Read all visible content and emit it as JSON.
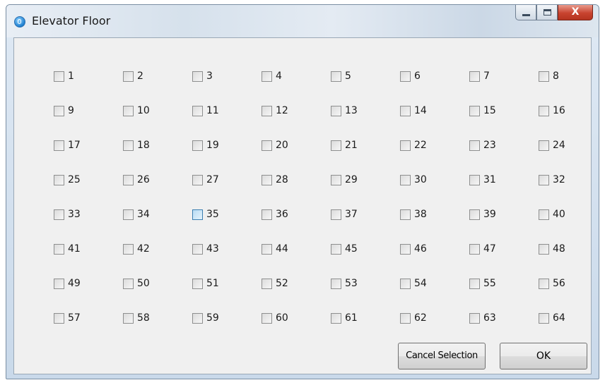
{
  "window": {
    "title": "Elevator Floor",
    "close_glyph": "X"
  },
  "floors": [
    "1",
    "2",
    "3",
    "4",
    "5",
    "6",
    "7",
    "8",
    "9",
    "10",
    "11",
    "12",
    "13",
    "14",
    "15",
    "16",
    "17",
    "18",
    "19",
    "20",
    "21",
    "22",
    "23",
    "24",
    "25",
    "26",
    "27",
    "28",
    "29",
    "30",
    "31",
    "32",
    "33",
    "34",
    "35",
    "36",
    "37",
    "38",
    "39",
    "40",
    "41",
    "42",
    "43",
    "44",
    "45",
    "46",
    "47",
    "48",
    "49",
    "50",
    "51",
    "52",
    "53",
    "54",
    "55",
    "56",
    "57",
    "58",
    "59",
    "60",
    "61",
    "62",
    "63",
    "64"
  ],
  "hovered_floor": "35",
  "buttons": {
    "cancel_label": "Cancel Selection",
    "ok_label": "OK"
  },
  "icons": {
    "app": "elevator-app-icon",
    "minimize": "minimize-icon",
    "maximize": "maximize-icon",
    "close": "close-icon"
  },
  "colors": {
    "titlebar": "#dde6ef",
    "client_background": "#f0f0f0",
    "close_button": "#c8432f",
    "checkbox_hover": "#b9dcf4"
  }
}
